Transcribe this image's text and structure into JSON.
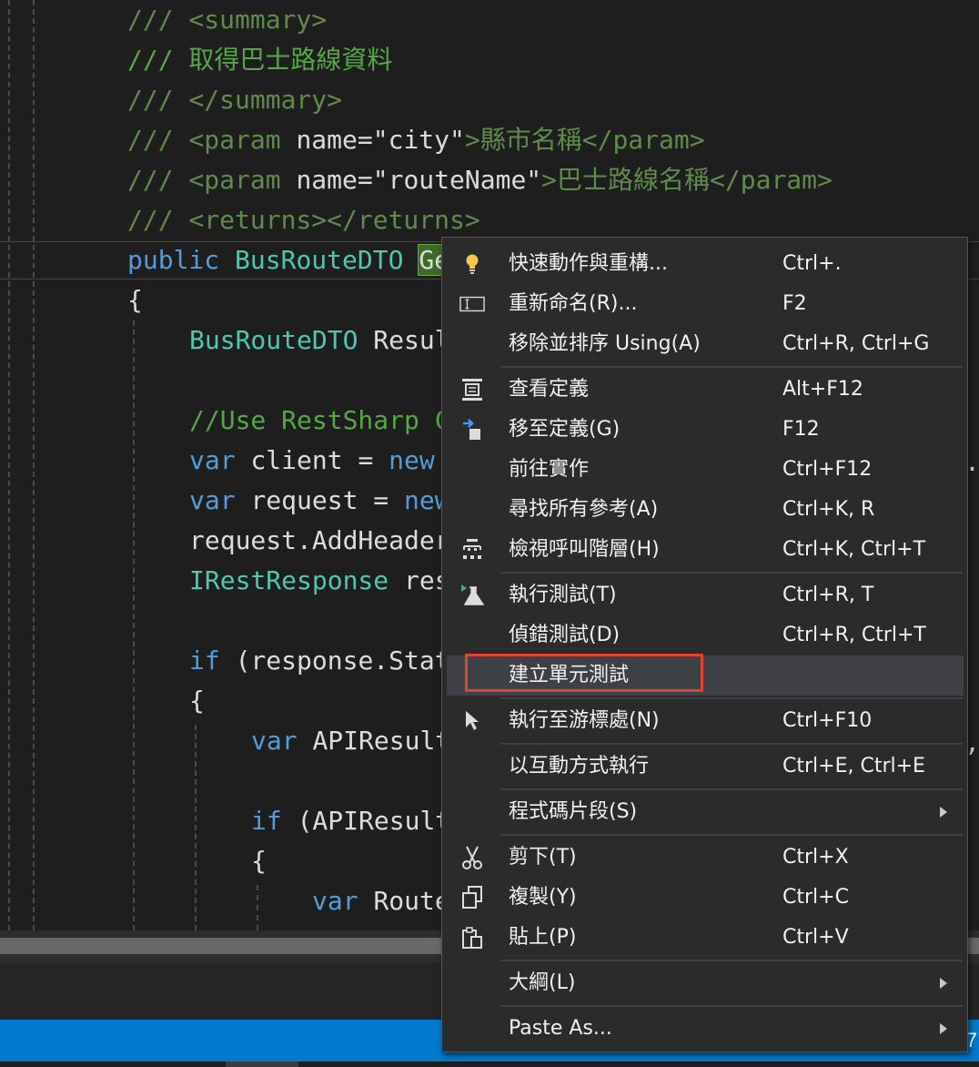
{
  "editor": {
    "lines": [
      [
        {
          "t": "/// <summary>",
          "c": "cg"
        }
      ],
      [
        {
          "t": "/// 取得巴士路線資料",
          "c": "c"
        }
      ],
      [
        {
          "t": "/// </summary>",
          "c": "cg"
        }
      ],
      [
        {
          "t": "/// <param ",
          "c": "cg"
        },
        {
          "t": "name=\"city\"",
          "c": "p"
        },
        {
          "t": ">縣市名稱</param>",
          "c": "cg"
        }
      ],
      [
        {
          "t": "/// <param ",
          "c": "cg"
        },
        {
          "t": "name=\"routeName\"",
          "c": "p"
        },
        {
          "t": ">巴士路線名稱</param>",
          "c": "cg"
        }
      ],
      [
        {
          "t": "/// <returns></returns>",
          "c": "cg"
        }
      ],
      [
        {
          "t": "public ",
          "c": "k"
        },
        {
          "t": "BusRouteDTO ",
          "c": "t"
        },
        {
          "t": "Ge",
          "c": "p hl"
        }
      ],
      [
        {
          "t": "{",
          "c": "p"
        }
      ],
      [
        {
          "t": "BusRouteDTO ",
          "c": "t"
        },
        {
          "t": "Resul",
          "c": "p"
        }
      ],
      [],
      [
        {
          "t": "//Use RestSharp C",
          "c": "c"
        }
      ],
      [
        {
          "t": "var ",
          "c": "k"
        },
        {
          "t": "client = ",
          "c": "p"
        },
        {
          "t": "new",
          "c": "k"
        }
      ],
      [
        {
          "t": "var ",
          "c": "k"
        },
        {
          "t": "request = ",
          "c": "p"
        },
        {
          "t": "new",
          "c": "k"
        }
      ],
      [
        {
          "t": "request.AddHeader",
          "c": "p"
        }
      ],
      [
        {
          "t": "IRestResponse ",
          "c": "t"
        },
        {
          "t": "res",
          "c": "p"
        }
      ],
      [],
      [
        {
          "t": "if ",
          "c": "k"
        },
        {
          "t": "(response.Stat",
          "c": "p"
        }
      ],
      [
        {
          "t": "{",
          "c": "p"
        }
      ],
      [
        {
          "t": "var ",
          "c": "k"
        },
        {
          "t": "APIResult",
          "c": "p"
        }
      ],
      [],
      [
        {
          "t": "if ",
          "c": "k"
        },
        {
          "t": "(APIResult",
          "c": "p"
        }
      ],
      [
        {
          "t": "{",
          "c": "p"
        }
      ],
      [
        {
          "t": "var ",
          "c": "k"
        },
        {
          "t": "Route",
          "c": "p"
        }
      ]
    ],
    "right_fragments": [
      ".a",
      ",i"
    ]
  },
  "status": {
    "right_text": "7"
  },
  "context_menu": {
    "items": [
      {
        "label": "快速動作與重構...",
        "shortcut": "Ctrl+.",
        "icon": "lightbulb-icon"
      },
      {
        "label": "重新命名(R)...",
        "shortcut": "F2",
        "icon": "rename-icon"
      },
      {
        "label": "移除並排序 Using(A)",
        "shortcut": "Ctrl+R, Ctrl+G",
        "icon": ""
      },
      {
        "label": "查看定義",
        "shortcut": "Alt+F12",
        "icon": "peek-definition-icon"
      },
      {
        "label": "移至定義(G)",
        "shortcut": "F12",
        "icon": "go-to-definition-icon"
      },
      {
        "label": "前往實作",
        "shortcut": "Ctrl+F12",
        "icon": ""
      },
      {
        "label": "尋找所有參考(A)",
        "shortcut": "Ctrl+K, R",
        "icon": ""
      },
      {
        "label": "檢視呼叫階層(H)",
        "shortcut": "Ctrl+K, Ctrl+T",
        "icon": "call-hierarchy-icon"
      },
      {
        "label": "執行測試(T)",
        "shortcut": "Ctrl+R, T",
        "icon": "run-test-icon"
      },
      {
        "label": "偵錯測試(D)",
        "shortcut": "Ctrl+R, Ctrl+T",
        "icon": ""
      },
      {
        "label": "建立單元測試",
        "shortcut": "",
        "icon": "",
        "hover": true
      },
      {
        "label": "執行至游標處(N)",
        "shortcut": "Ctrl+F10",
        "icon": "cursor-icon"
      },
      {
        "label": "以互動方式執行",
        "shortcut": "Ctrl+E, Ctrl+E",
        "icon": ""
      },
      {
        "label": "程式碼片段(S)",
        "shortcut": "",
        "icon": "",
        "submenu": true
      },
      {
        "label": "剪下(T)",
        "shortcut": "Ctrl+X",
        "icon": "scissors-icon"
      },
      {
        "label": "複製(Y)",
        "shortcut": "Ctrl+C",
        "icon": "copy-icon"
      },
      {
        "label": "貼上(P)",
        "shortcut": "Ctrl+V",
        "icon": "paste-icon"
      },
      {
        "label": "大綱(L)",
        "shortcut": "",
        "icon": "",
        "submenu": true
      },
      {
        "label": "Paste As...",
        "shortcut": "",
        "icon": "",
        "submenu": true
      }
    ]
  },
  "colors": {
    "highlight_border": "#e0432f",
    "status_bar": "#007acc"
  }
}
